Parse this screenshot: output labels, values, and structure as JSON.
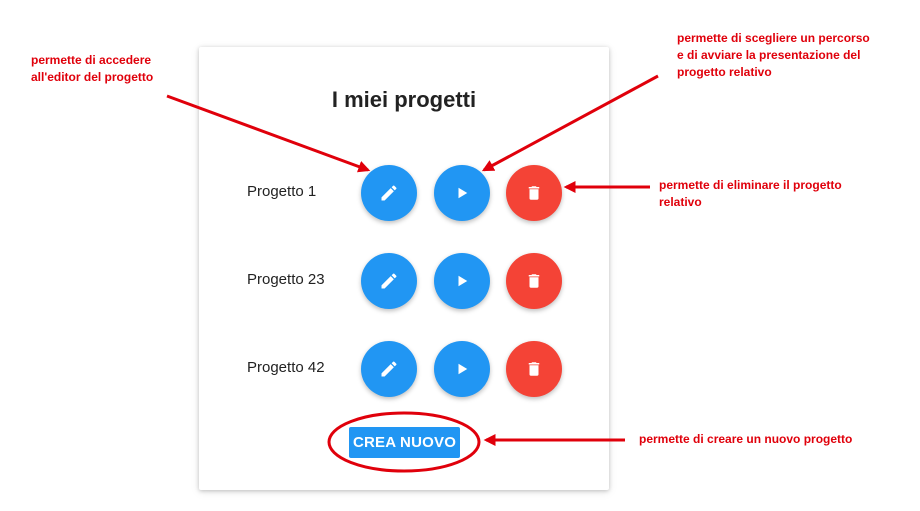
{
  "card": {
    "title": "I miei progetti",
    "projects": [
      {
        "name": "Progetto 1"
      },
      {
        "name": "Progetto 23"
      },
      {
        "name": "Progetto 42"
      }
    ],
    "create_label": "CREA NUOVO"
  },
  "annotations": {
    "edit_note": [
      "permette di accedere",
      "all'editor del progetto"
    ],
    "play_note": [
      "permette di scegliere un percorso",
      "e di avviare la presentazione del",
      "progetto relativo"
    ],
    "delete_note": [
      "permette di eliminare il progetto",
      "relativo"
    ],
    "create_note": [
      "permette di creare un nuovo progetto"
    ]
  },
  "colors": {
    "primary": "#2196f3",
    "danger": "#f44336",
    "annotation": "#e0000b",
    "text": "#222222"
  },
  "icons": {
    "edit": "pencil-icon",
    "play": "play-icon",
    "delete": "trash-icon"
  }
}
